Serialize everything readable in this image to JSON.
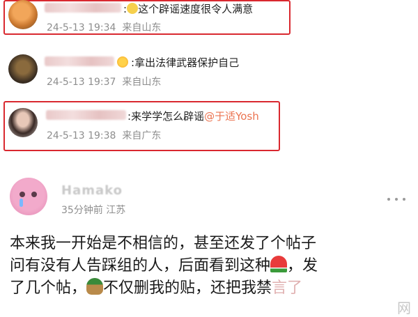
{
  "comments": [
    {
      "sep": ":",
      "text": "这个辟谣速度很令人满意",
      "time": "24-5-13 19:34",
      "location": "来自山东"
    },
    {
      "sep": ":",
      "text": "拿出法律武器保护自己",
      "time": "24-5-13 19:37",
      "location": "来自山东"
    },
    {
      "sep": ":",
      "text": "来学学怎么辟谣",
      "mention": "@于适Yosh",
      "time": "24-5-13 19:38",
      "location": "来自广东"
    }
  ],
  "post": {
    "author": "Hamako",
    "time": "35分钟前",
    "location": "江苏",
    "line1": "本来我一开始是不相信的，甚至还发了个帖子",
    "line2a": "问有没有人告踩组的人，后面看到这种",
    "line2b": "，发",
    "line3a": "了几个帖，",
    "line3b": "不仅删我的贴，还把我禁",
    "line3c": "言了"
  },
  "watermark": {
    "text": "网"
  },
  "colors": {
    "highlight": "#d9282f",
    "mention": "#eb7350"
  }
}
